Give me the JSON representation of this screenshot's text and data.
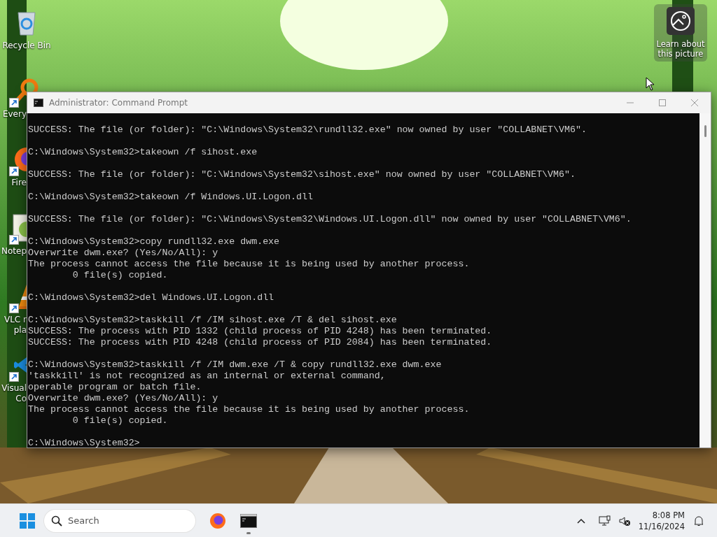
{
  "desktop": {
    "icons": [
      {
        "kind": "recycle-bin",
        "label_lines": [
          "Recycle Bin"
        ],
        "shortcut": false,
        "clipped": false
      },
      {
        "kind": "search-tool",
        "label_lines": [
          "Every"
        ],
        "shortcut": true,
        "clipped": true
      },
      {
        "kind": "browser",
        "label_lines": [
          "Fire"
        ],
        "shortcut": true,
        "clipped": true
      },
      {
        "kind": "notepad",
        "label_lines": [
          "Notep"
        ],
        "shortcut": true,
        "clipped": true
      },
      {
        "kind": "cone",
        "label_lines": [
          "VLC r",
          "pla"
        ],
        "shortcut": true,
        "clipped": true
      },
      {
        "kind": "code",
        "label_lines": [
          "Visual",
          "Co"
        ],
        "shortcut": true,
        "clipped": true
      }
    ],
    "spotlight": {
      "lines": [
        "Learn about",
        "this picture"
      ]
    }
  },
  "window": {
    "title": "Administrator: Command Prompt",
    "console": {
      "blocks": [
        [
          "SUCCESS: The file (or folder): \"C:\\Windows\\System32\\rundll32.exe\" now owned by user \"COLLABNET\\VM6\"."
        ],
        [
          "C:\\Windows\\System32>takeown /f sihost.exe"
        ],
        [
          "SUCCESS: The file (or folder): \"C:\\Windows\\System32\\sihost.exe\" now owned by user \"COLLABNET\\VM6\"."
        ],
        [
          "C:\\Windows\\System32>takeown /f Windows.UI.Logon.dll"
        ],
        [
          "SUCCESS: The file (or folder): \"C:\\Windows\\System32\\Windows.UI.Logon.dll\" now owned by user \"COLLABNET\\VM6\"."
        ],
        [
          "C:\\Windows\\System32>copy rundll32.exe dwm.exe",
          "Overwrite dwm.exe? (Yes/No/All): y",
          "The process cannot access the file because it is being used by another process.",
          "        0 file(s) copied."
        ],
        [
          "C:\\Windows\\System32>del Windows.UI.Logon.dll"
        ],
        [
          "C:\\Windows\\System32>taskkill /f /IM sihost.exe /T & del sihost.exe",
          "SUCCESS: The process with PID 1332 (child process of PID 4248) has been terminated.",
          "SUCCESS: The process with PID 4248 (child process of PID 2084) has been terminated."
        ],
        [
          "C:\\Windows\\System32>taskkill /f /IM dwm.exe /T & copy rundll32.exe dwm.exe",
          "'taskkill' is not recognized as an internal or external command,",
          "operable program or batch file.",
          "Overwrite dwm.exe? (Yes/No/All): y",
          "The process cannot access the file because it is being used by another process.",
          "        0 file(s) copied."
        ],
        [
          "C:\\Windows\\System32>"
        ]
      ]
    }
  },
  "taskbar": {
    "search": {
      "placeholder": "Search"
    },
    "apps": [
      {
        "kind": "browser",
        "running": false
      },
      {
        "kind": "terminal",
        "running": true
      }
    ],
    "clock": {
      "time": "8:08 PM",
      "date": "11/16/2024"
    }
  }
}
